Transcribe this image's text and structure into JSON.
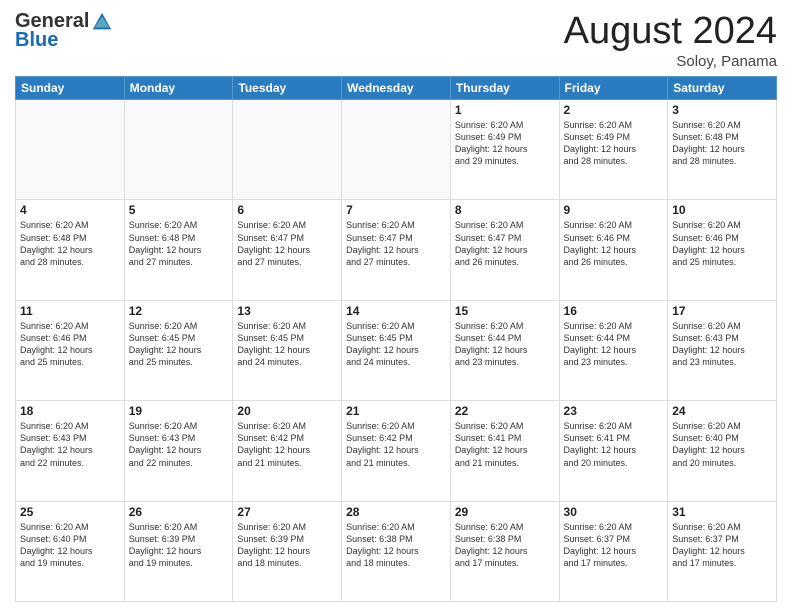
{
  "header": {
    "logo_general": "General",
    "logo_blue": "Blue",
    "title": "August 2024",
    "location": "Soloy, Panama"
  },
  "weekdays": [
    "Sunday",
    "Monday",
    "Tuesday",
    "Wednesday",
    "Thursday",
    "Friday",
    "Saturday"
  ],
  "weeks": [
    [
      {
        "day": "",
        "info": ""
      },
      {
        "day": "",
        "info": ""
      },
      {
        "day": "",
        "info": ""
      },
      {
        "day": "",
        "info": ""
      },
      {
        "day": "1",
        "info": "Sunrise: 6:20 AM\nSunset: 6:49 PM\nDaylight: 12 hours\nand 29 minutes."
      },
      {
        "day": "2",
        "info": "Sunrise: 6:20 AM\nSunset: 6:49 PM\nDaylight: 12 hours\nand 28 minutes."
      },
      {
        "day": "3",
        "info": "Sunrise: 6:20 AM\nSunset: 6:48 PM\nDaylight: 12 hours\nand 28 minutes."
      }
    ],
    [
      {
        "day": "4",
        "info": "Sunrise: 6:20 AM\nSunset: 6:48 PM\nDaylight: 12 hours\nand 28 minutes."
      },
      {
        "day": "5",
        "info": "Sunrise: 6:20 AM\nSunset: 6:48 PM\nDaylight: 12 hours\nand 27 minutes."
      },
      {
        "day": "6",
        "info": "Sunrise: 6:20 AM\nSunset: 6:47 PM\nDaylight: 12 hours\nand 27 minutes."
      },
      {
        "day": "7",
        "info": "Sunrise: 6:20 AM\nSunset: 6:47 PM\nDaylight: 12 hours\nand 27 minutes."
      },
      {
        "day": "8",
        "info": "Sunrise: 6:20 AM\nSunset: 6:47 PM\nDaylight: 12 hours\nand 26 minutes."
      },
      {
        "day": "9",
        "info": "Sunrise: 6:20 AM\nSunset: 6:46 PM\nDaylight: 12 hours\nand 26 minutes."
      },
      {
        "day": "10",
        "info": "Sunrise: 6:20 AM\nSunset: 6:46 PM\nDaylight: 12 hours\nand 25 minutes."
      }
    ],
    [
      {
        "day": "11",
        "info": "Sunrise: 6:20 AM\nSunset: 6:46 PM\nDaylight: 12 hours\nand 25 minutes."
      },
      {
        "day": "12",
        "info": "Sunrise: 6:20 AM\nSunset: 6:45 PM\nDaylight: 12 hours\nand 25 minutes."
      },
      {
        "day": "13",
        "info": "Sunrise: 6:20 AM\nSunset: 6:45 PM\nDaylight: 12 hours\nand 24 minutes."
      },
      {
        "day": "14",
        "info": "Sunrise: 6:20 AM\nSunset: 6:45 PM\nDaylight: 12 hours\nand 24 minutes."
      },
      {
        "day": "15",
        "info": "Sunrise: 6:20 AM\nSunset: 6:44 PM\nDaylight: 12 hours\nand 23 minutes."
      },
      {
        "day": "16",
        "info": "Sunrise: 6:20 AM\nSunset: 6:44 PM\nDaylight: 12 hours\nand 23 minutes."
      },
      {
        "day": "17",
        "info": "Sunrise: 6:20 AM\nSunset: 6:43 PM\nDaylight: 12 hours\nand 23 minutes."
      }
    ],
    [
      {
        "day": "18",
        "info": "Sunrise: 6:20 AM\nSunset: 6:43 PM\nDaylight: 12 hours\nand 22 minutes."
      },
      {
        "day": "19",
        "info": "Sunrise: 6:20 AM\nSunset: 6:43 PM\nDaylight: 12 hours\nand 22 minutes."
      },
      {
        "day": "20",
        "info": "Sunrise: 6:20 AM\nSunset: 6:42 PM\nDaylight: 12 hours\nand 21 minutes."
      },
      {
        "day": "21",
        "info": "Sunrise: 6:20 AM\nSunset: 6:42 PM\nDaylight: 12 hours\nand 21 minutes."
      },
      {
        "day": "22",
        "info": "Sunrise: 6:20 AM\nSunset: 6:41 PM\nDaylight: 12 hours\nand 21 minutes."
      },
      {
        "day": "23",
        "info": "Sunrise: 6:20 AM\nSunset: 6:41 PM\nDaylight: 12 hours\nand 20 minutes."
      },
      {
        "day": "24",
        "info": "Sunrise: 6:20 AM\nSunset: 6:40 PM\nDaylight: 12 hours\nand 20 minutes."
      }
    ],
    [
      {
        "day": "25",
        "info": "Sunrise: 6:20 AM\nSunset: 6:40 PM\nDaylight: 12 hours\nand 19 minutes."
      },
      {
        "day": "26",
        "info": "Sunrise: 6:20 AM\nSunset: 6:39 PM\nDaylight: 12 hours\nand 19 minutes."
      },
      {
        "day": "27",
        "info": "Sunrise: 6:20 AM\nSunset: 6:39 PM\nDaylight: 12 hours\nand 18 minutes."
      },
      {
        "day": "28",
        "info": "Sunrise: 6:20 AM\nSunset: 6:38 PM\nDaylight: 12 hours\nand 18 minutes."
      },
      {
        "day": "29",
        "info": "Sunrise: 6:20 AM\nSunset: 6:38 PM\nDaylight: 12 hours\nand 17 minutes."
      },
      {
        "day": "30",
        "info": "Sunrise: 6:20 AM\nSunset: 6:37 PM\nDaylight: 12 hours\nand 17 minutes."
      },
      {
        "day": "31",
        "info": "Sunrise: 6:20 AM\nSunset: 6:37 PM\nDaylight: 12 hours\nand 17 minutes."
      }
    ]
  ]
}
